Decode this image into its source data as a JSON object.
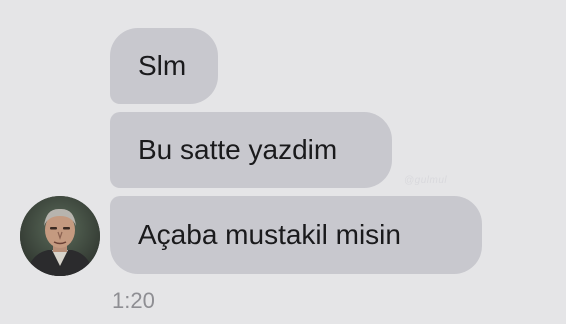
{
  "conversation": {
    "messages": [
      {
        "text": "Slm"
      },
      {
        "text": "Bu satte yazdim"
      },
      {
        "text": "Açaba mustakil misin"
      }
    ],
    "timestamp": "1:20",
    "watermark": "@gulmul"
  },
  "colors": {
    "background": "#e5e5e7",
    "bubble": "#c8c8ce",
    "text": "#1a1a1c",
    "timestamp": "#8e8e93"
  },
  "icons": {
    "avatar": "contact-avatar-photo"
  }
}
